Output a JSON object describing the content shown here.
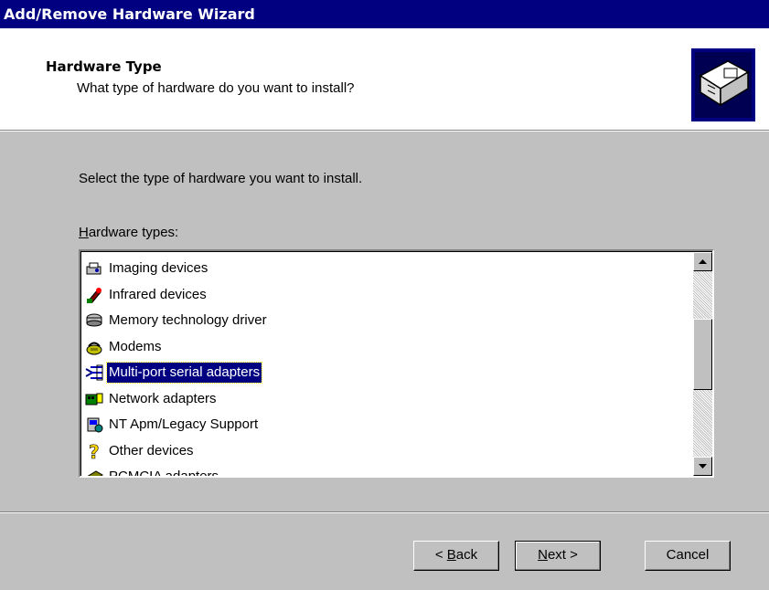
{
  "window": {
    "title": "Add/Remove Hardware Wizard"
  },
  "header": {
    "title": "Hardware Type",
    "subtitle": "What type of hardware do you want to install?",
    "icon": "hardware-card-icon"
  },
  "body": {
    "instruction": "Select the type of hardware you want to install.",
    "list_label_accel": "H",
    "list_label_rest": "ardware types:"
  },
  "hardware_types": [
    {
      "label": "Imaging devices",
      "icon": "imaging-device-icon"
    },
    {
      "label": "Infrared devices",
      "icon": "infrared-device-icon"
    },
    {
      "label": "Memory technology driver",
      "icon": "memory-driver-icon"
    },
    {
      "label": "Modems",
      "icon": "modem-icon"
    },
    {
      "label": "Multi-port serial adapters",
      "icon": "serial-adapter-icon",
      "selected": true
    },
    {
      "label": "Network adapters",
      "icon": "network-adapter-icon"
    },
    {
      "label": "NT Apm/Legacy Support",
      "icon": "legacy-support-icon"
    },
    {
      "label": "Other devices",
      "icon": "question-mark-icon"
    },
    {
      "label": "PCMCIA adapters",
      "icon": "pcmcia-adapter-icon"
    }
  ],
  "buttons": {
    "back_pre": "< ",
    "back_accel": "B",
    "back_post": "ack",
    "next_accel": "N",
    "next_post": "ext >",
    "cancel": "Cancel"
  },
  "colors": {
    "titlebar": "#000080",
    "selection": "#000080",
    "face": "#c0c0c0"
  }
}
